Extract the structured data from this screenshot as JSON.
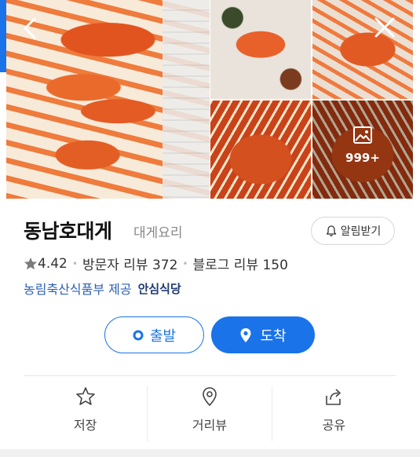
{
  "gallery": {
    "more_count": "999+",
    "icons": {
      "back": "chevron-left-icon",
      "close": "close-icon",
      "photos": "photo-icon"
    }
  },
  "place": {
    "name": "동남호대게",
    "category": "대게요리",
    "alert_label": "알림받기",
    "rating": "4.42",
    "visitor_reviews": "방문자 리뷰 372",
    "blog_reviews": "블로그 리뷰 150",
    "provider": "농림축산식품부 제공",
    "safe_badge": "안심식당"
  },
  "route": {
    "depart_label": "출발",
    "arrive_label": "도착"
  },
  "actions": [
    {
      "label": "저장",
      "icon": "star-icon"
    },
    {
      "label": "거리뷰",
      "icon": "map-pin-icon"
    },
    {
      "label": "공유",
      "icon": "share-icon"
    }
  ],
  "colors": {
    "accent": "#1a73e8",
    "provider": "#2b5fb4",
    "text": "#111111",
    "muted": "#888888"
  }
}
